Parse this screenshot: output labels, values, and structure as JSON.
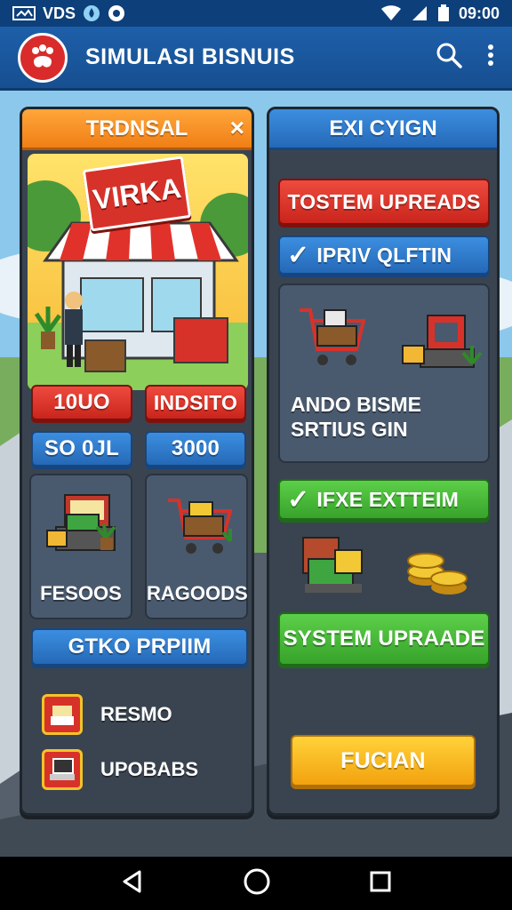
{
  "status_bar": {
    "left_text": "VDS",
    "time": "09:00"
  },
  "app_bar": {
    "title": "SIMULASI BISNUIS",
    "logo_icon": "paw-logo-icon",
    "actions": [
      "search-icon",
      "more-vert-icon"
    ]
  },
  "left_panel": {
    "header": "TRDNSAL",
    "close_label": "×",
    "shop_sign": "VIRKA",
    "buttons_row1": [
      "10UO",
      "INDSITO"
    ],
    "buttons_row2": [
      "SO 0JL",
      "3000"
    ],
    "cards": [
      {
        "label": "FESOOS",
        "icon": "cash-register-icon"
      },
      {
        "label": "RAGOODS",
        "icon": "shopping-cart-icon"
      }
    ],
    "section_button": "GTKO PRPIIM",
    "list": [
      {
        "label": "RESMO",
        "icon": "cash-register-icon"
      },
      {
        "label": "UPOBABS",
        "icon": "laptop-icon"
      }
    ]
  },
  "right_panel": {
    "header": "EXI CYIGN",
    "red_button": "TOSTEM UPREADS",
    "check_button_1": "IPRIV QLFTIN",
    "card_text": "ANDO BISME SRTIUS GIN",
    "check_button_2": "IFXE EXTTEIM",
    "green_button": "SYSTEM UPRAADE",
    "yellow_button": "FUCIAN",
    "check_mark": "✓"
  },
  "colors": {
    "app_bar": "#1d5fa9",
    "panel": "#3a4450",
    "accent_orange": "#f07f16",
    "accent_red": "#c9251c",
    "accent_green": "#37a32a",
    "accent_yellow": "#f2a20e"
  }
}
